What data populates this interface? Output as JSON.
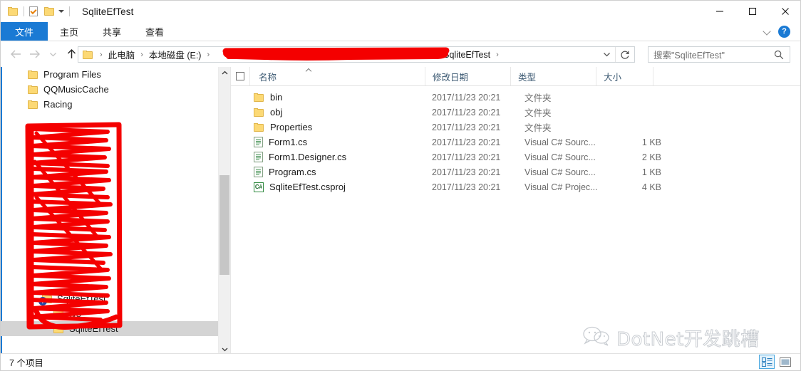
{
  "window": {
    "title": "SqliteEfTest",
    "quick_access": [
      {
        "name": "folder-icon",
        "label": "folder"
      },
      {
        "name": "properties-icon",
        "label": "properties"
      },
      {
        "name": "new-folder-icon",
        "label": "new folder"
      },
      {
        "name": "customize-caret-icon",
        "label": "customize"
      }
    ],
    "controls": {
      "minimize": "minimize",
      "maximize": "maximize",
      "close": "close"
    }
  },
  "ribbon": {
    "tabs": [
      {
        "label": "文件",
        "active": true
      },
      {
        "label": "主页",
        "active": false
      },
      {
        "label": "共享",
        "active": false
      },
      {
        "label": "查看",
        "active": false
      }
    ],
    "expand_icon": "chevron-down-icon",
    "help_label": "?"
  },
  "navigation": {
    "back": "←",
    "forward": "→",
    "history": "⌄",
    "up": "↑",
    "breadcrumbs": [
      {
        "label": "此电脑"
      },
      {
        "label": "本地磁盘 (E:)"
      },
      {
        "label": "",
        "redacted": true
      },
      {
        "label": "SqliteEfTest"
      }
    ],
    "dropdown_icon": "chevron-down-icon",
    "refresh_icon": "refresh-icon"
  },
  "search": {
    "placeholder": "搜索\"SqliteEfTest\"",
    "icon": "search-icon"
  },
  "tree": {
    "items": [
      {
        "label": "Program Files",
        "icon": "folder-icon",
        "indent": 38,
        "selected": false,
        "badge": false
      },
      {
        "label": "QQMusicCache",
        "icon": "folder-icon",
        "indent": 38,
        "selected": false,
        "badge": false
      },
      {
        "label": "Racing",
        "icon": "folder-icon",
        "indent": 38,
        "selected": false,
        "badge": false
      },
      {
        "label": "SqliteEfTest",
        "icon": "folder-icon",
        "indent": 56,
        "selected": false,
        "badge": true
      },
      {
        "label": ".vs",
        "icon": "folder-icon",
        "indent": 74,
        "selected": false,
        "badge": false
      },
      {
        "label": "SqliteEfTest",
        "icon": "folder-icon",
        "indent": 74,
        "selected": true,
        "badge": false
      }
    ],
    "scroll_up_icon": "chevron-up-icon",
    "scroll_down_icon": "chevron-down-icon"
  },
  "file_list": {
    "columns": [
      {
        "label": "名称",
        "key": "name"
      },
      {
        "label": "修改日期",
        "key": "date"
      },
      {
        "label": "类型",
        "key": "type"
      },
      {
        "label": "大小",
        "key": "size"
      }
    ],
    "sort": {
      "column": "名称",
      "direction": "asc",
      "icon": "sort-asc-caret-icon"
    },
    "select_all_checkbox": "select-all-checkbox",
    "rows": [
      {
        "name": "bin",
        "date": "2017/11/23 20:21",
        "type": "文件夹",
        "size": "",
        "icon": "folder-icon"
      },
      {
        "name": "obj",
        "date": "2017/11/23 20:21",
        "type": "文件夹",
        "size": "",
        "icon": "folder-icon"
      },
      {
        "name": "Properties",
        "date": "2017/11/23 20:21",
        "type": "文件夹",
        "size": "",
        "icon": "folder-icon"
      },
      {
        "name": "Form1.cs",
        "date": "2017/11/23 20:21",
        "type": "Visual C# Sourc...",
        "size": "1 KB",
        "icon": "source-file-icon"
      },
      {
        "name": "Form1.Designer.cs",
        "date": "2017/11/23 20:21",
        "type": "Visual C# Sourc...",
        "size": "2 KB",
        "icon": "source-file-icon"
      },
      {
        "name": "Program.cs",
        "date": "2017/11/23 20:21",
        "type": "Visual C# Sourc...",
        "size": "1 KB",
        "icon": "source-file-icon"
      },
      {
        "name": "SqliteEfTest.csproj",
        "date": "2017/11/23 20:21",
        "type": "Visual C# Projec...",
        "size": "4 KB",
        "icon": "csharp-project-icon",
        "csharp_glyph": "C#"
      }
    ]
  },
  "status": {
    "item_count_text": "7 个项目",
    "view_details": "details-view",
    "view_large_icons": "large-icons-view"
  },
  "watermark": {
    "text": "DotNet开发跳槽",
    "icon": "wechat-icon"
  },
  "colors": {
    "accent_blue": "#1a7ad4",
    "redaction_red": "#f40000",
    "selection_gray": "#d4d4d4",
    "folder_yellow": "#fcd975",
    "header_text": "#3d5a73"
  }
}
